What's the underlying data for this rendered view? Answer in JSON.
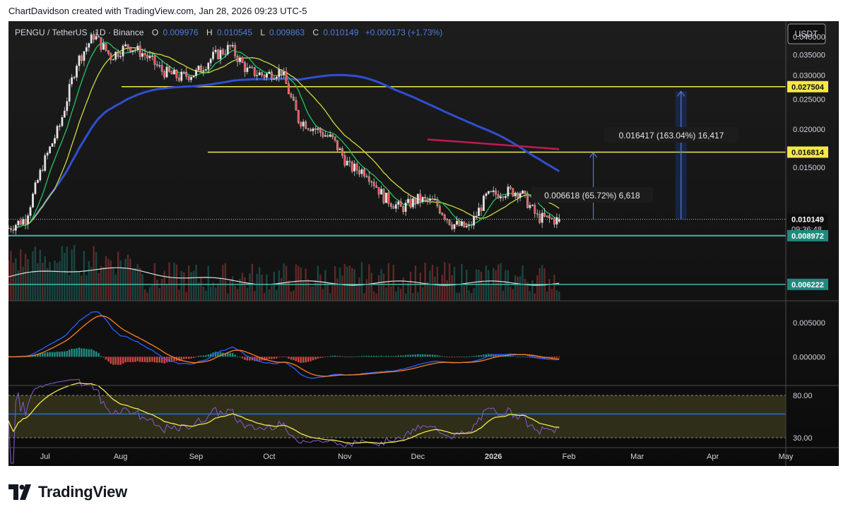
{
  "header": {
    "attribution": "ChartDavidson created with TradingView.com, Jan 28, 2026 09:23 UTC-5"
  },
  "legend": {
    "symbol": "PENGU / TetherUS · 1D · Binance",
    "o_label": "O",
    "o_value": "0.009976",
    "h_label": "H",
    "h_value": "0.010545",
    "l_label": "L",
    "l_value": "0.009863",
    "c_label": "C",
    "c_value": "0.010149",
    "change": "+0.000173 (+1.73%)"
  },
  "currency_button": "USDT",
  "price_axis": {
    "ticks": [
      "0.040000",
      "0.035000",
      "0.030000",
      "0.025000",
      "0.020000",
      "0.015000"
    ],
    "labels": {
      "current_price": "0.010149",
      "countdown": "09:36:48",
      "level_upper": "0.027504",
      "level_mid": "0.016814",
      "level_support": "0.008972",
      "level_low": "0.006222"
    }
  },
  "measurements": [
    {
      "text": "0.016417 (163.04%) 16,417"
    },
    {
      "text": "0.006618 (65.72%) 6,618"
    }
  ],
  "macd_axis": {
    "ticks": [
      "0.005000",
      "0.000000"
    ]
  },
  "rsi_axis": {
    "ticks": [
      "80.00",
      "30.00"
    ]
  },
  "time_axis": {
    "labels": [
      "Jul",
      "Aug",
      "Sep",
      "Oct",
      "Nov",
      "Dec",
      "2026",
      "Feb",
      "Mar",
      "Apr",
      "May"
    ]
  },
  "footer": {
    "brand": "TradingView"
  },
  "colors": {
    "background": "#0e0e0e",
    "up": "#26a69a",
    "down": "#ef5350",
    "ma_fast": "#22c55e",
    "ma_slow": "#cddc39",
    "ma_long": "#2f4fd1",
    "level_line": "#f5e84a",
    "support_line": "#3fb8a9",
    "trendline": "#c2185b",
    "macd_line": "#2962ff",
    "signal_line": "#ff7f27",
    "rsi_line": "#7e57c2",
    "rsi_ma": "#f5e84a"
  },
  "chart_data": {
    "type": "candlestick",
    "title": "PENGU / TetherUS · 1D · Binance",
    "x_range": [
      "2025-06-16",
      "2026-05-01"
    ],
    "ylim": [
      0.0055,
      0.045
    ],
    "weekly_close_approx": [
      [
        "2025-06-16",
        0.0095
      ],
      [
        "2025-06-23",
        0.0102
      ],
      [
        "2025-06-30",
        0.0152
      ],
      [
        "2025-07-07",
        0.0205
      ],
      [
        "2025-07-14",
        0.033
      ],
      [
        "2025-07-21",
        0.0405
      ],
      [
        "2025-07-28",
        0.0345
      ],
      [
        "2025-08-04",
        0.0375
      ],
      [
        "2025-08-11",
        0.035
      ],
      [
        "2025-08-18",
        0.031
      ],
      [
        "2025-08-25",
        0.0295
      ],
      [
        "2025-09-01",
        0.0305
      ],
      [
        "2025-09-08",
        0.0345
      ],
      [
        "2025-09-15",
        0.037
      ],
      [
        "2025-09-22",
        0.031
      ],
      [
        "2025-09-29",
        0.03
      ],
      [
        "2025-10-06",
        0.031
      ],
      [
        "2025-10-13",
        0.0215
      ],
      [
        "2025-10-20",
        0.02
      ],
      [
        "2025-10-27",
        0.0185
      ],
      [
        "2025-11-03",
        0.015
      ],
      [
        "2025-11-10",
        0.0145
      ],
      [
        "2025-11-17",
        0.012
      ],
      [
        "2025-11-24",
        0.011
      ],
      [
        "2025-12-01",
        0.0118
      ],
      [
        "2025-12-08",
        0.0115
      ],
      [
        "2025-12-15",
        0.0098
      ],
      [
        "2025-12-22",
        0.0095
      ],
      [
        "2025-12-29",
        0.012
      ],
      [
        "2026-01-05",
        0.0125
      ],
      [
        "2026-01-12",
        0.0125
      ],
      [
        "2026-01-19",
        0.0103
      ],
      [
        "2026-01-26",
        0.0101
      ]
    ],
    "horizontal_levels": [
      0.027504,
      0.016814,
      0.008972,
      0.006222
    ],
    "measurements": [
      {
        "from": 0.010149,
        "to": 0.016767,
        "change": 0.006618,
        "percent": 65.72
      },
      {
        "from": 0.010149,
        "to": 0.026566,
        "change": 0.016417,
        "percent": 163.04
      }
    ],
    "macd_ylim": [
      -0.004,
      0.008
    ],
    "rsi_ylim": [
      20,
      90
    ],
    "rsi_bands": [
      80,
      30
    ]
  }
}
